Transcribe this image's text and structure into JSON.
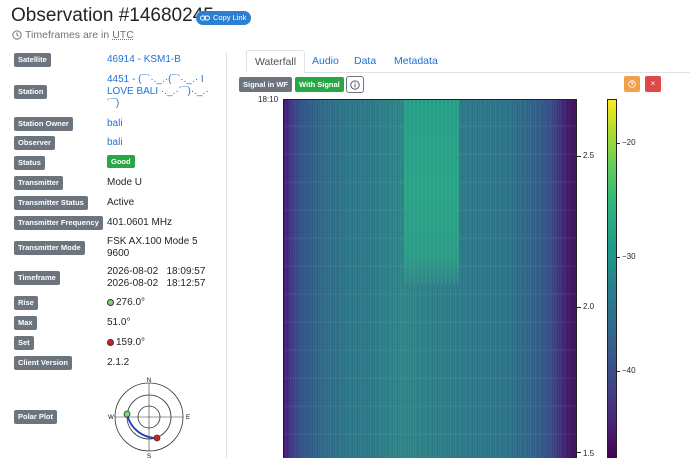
{
  "header": {
    "title": "Observation #14680245",
    "copy_link_label": "Copy Link",
    "subtitle_prefix": "Timeframes are in",
    "subtitle_tz": "UTC"
  },
  "details": {
    "satellite_label": "Satellite",
    "satellite_value": "46914 - KSM1-B",
    "station_label": "Station",
    "station_value_line1": "4451 - (¯`·._.·(¯`·._.· I",
    "station_value_line2": "LOVE BALI ·._.·´¯)·._.·",
    "station_value_line3": "´¯)",
    "station_owner_label": "Station Owner",
    "station_owner_value": "bali",
    "observer_label": "Observer",
    "observer_value": "bali",
    "status_label": "Status",
    "status_value": "Good",
    "transmitter_label": "Transmitter",
    "transmitter_value": "Mode U",
    "transmitter_status_label": "Transmitter Status",
    "transmitter_status_value": "Active",
    "transmitter_frequency_label": "Transmitter Frequency",
    "transmitter_frequency_value": "401.0601 MHz",
    "transmitter_mode_label": "Transmitter Mode",
    "transmitter_mode_line1": "FSK AX.100 Mode 5",
    "transmitter_mode_line2": "9600",
    "timeframe_label": "Timeframe",
    "timeframe_start_date": "2026-08-02",
    "timeframe_start_time": "18:09:57",
    "timeframe_end_date": "2026-08-02",
    "timeframe_end_time": "18:12:57",
    "rise_label": "Rise",
    "rise_value": "276.0°",
    "max_label": "Max",
    "max_value": "51.0°",
    "set_label": "Set",
    "set_value": "159.0°",
    "client_version_label": "Client Version",
    "client_version_value": "2.1.2",
    "polar_plot_label": "Polar Plot",
    "polar_n": "N",
    "polar_e": "E",
    "polar_s": "S",
    "polar_w": "W"
  },
  "tabs": {
    "waterfall": "Waterfall",
    "audio": "Audio",
    "data": "Data",
    "metadata": "Metadata"
  },
  "waterfall": {
    "signal_in_wf": "Signal in WF",
    "with_signal": "With Signal",
    "start_time": "18:10",
    "y_tick_1": "2.5",
    "y_tick_2": "2.0",
    "y_tick_3": "1.5",
    "cbar_tick_1": "−20",
    "cbar_tick_2": "−30",
    "cbar_tick_3": "−40"
  },
  "colors": {
    "primary": "#2f7fd0",
    "secondary": "#6c757d",
    "success": "#28a745",
    "warning": "#f0a04b",
    "danger": "#e04848",
    "link": "#1a73d9"
  }
}
